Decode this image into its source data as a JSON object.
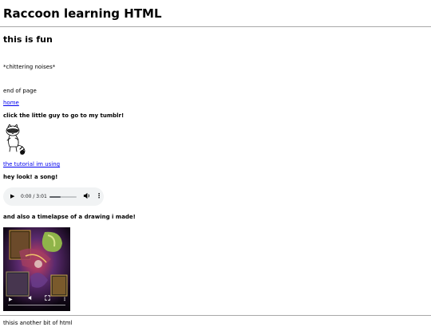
{
  "page": {
    "heading": "Raccoon learning HTML",
    "subheading": "this is fun",
    "chittering": "*chittering noises*",
    "end_text": "end of page",
    "home_link": "home",
    "tumblr_prompt": "click the little guy to go to my tumblr!",
    "tutorial_link": "the tutorial im using",
    "song_heading": "hey look! a song!",
    "timelapse_heading": "and also a timelapse of a drawing i made!",
    "footer_text": "thisis another bit of html"
  },
  "audio_player": {
    "time": "0:00 / 3:01",
    "progress": 0.4,
    "play_icon": "play-icon",
    "volume_icon": "volume-icon",
    "more_icon": "more-options-icon"
  },
  "video_player": {
    "play_icon": "play-icon",
    "volume_icon": "volume-icon",
    "fullscreen_icon": "fullscreen-icon",
    "more_icon": "more-options-icon"
  },
  "colors": {
    "link": "#0000ee",
    "rule": "#a8a8a8",
    "audio_bg": "#f1f3f4"
  }
}
